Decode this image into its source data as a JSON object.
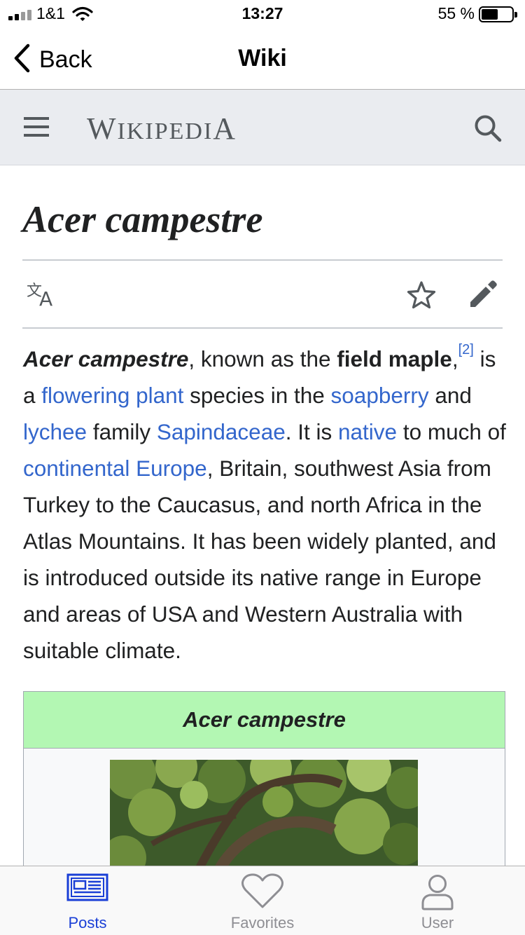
{
  "status_bar": {
    "carrier": "1&1",
    "time": "13:27",
    "battery_percent": "55 %",
    "battery_level": 0.55
  },
  "nav_bar": {
    "back_label": "Back",
    "title": "Wiki"
  },
  "wiki_header": {
    "wordmark": [
      "W",
      "IKIPEDI",
      "A"
    ]
  },
  "article": {
    "title": "Acer campestre",
    "lead": {
      "s1_bold_italic": "Acer campestre",
      "s1_text": ", known as the ",
      "s1_bold": "field maple",
      "s1_comma": ",",
      "ref": "[2]",
      "s2_text": " is a ",
      "link_flowering_plant": "flowering plant",
      "s3_text": " species in the ",
      "link_soapberry": "soapberry",
      "s4_text": " and ",
      "link_lychee": "lychee",
      "s5_text": " family ",
      "link_sapindaceae": "Sapindaceae",
      "s6_text": ". It is ",
      "link_native": "native",
      "s7_text": " to much of ",
      "link_continental_europe": "continental Europe",
      "s8_text": ", Britain, southwest Asia from Turkey to the Caucasus, and north Africa in the Atlas Mountains. It has been widely planted, and is introduced outside its native range in Europe and areas of USA and Western Australia with suitable climate."
    },
    "infobox": {
      "title": "Acer campestre"
    }
  },
  "tab_bar": {
    "tabs": [
      {
        "label": "Posts",
        "icon": "newspaper-icon",
        "active": true
      },
      {
        "label": "Favorites",
        "icon": "heart-icon",
        "active": false
      },
      {
        "label": "User",
        "icon": "user-icon",
        "active": false
      }
    ]
  },
  "colors": {
    "link": "#3366cc",
    "wiki_header_bg": "#eaecf0",
    "infobox_title_bg": "#b3f7b3",
    "tab_active": "#1a3fd6",
    "tab_inactive": "#8e8e93"
  }
}
